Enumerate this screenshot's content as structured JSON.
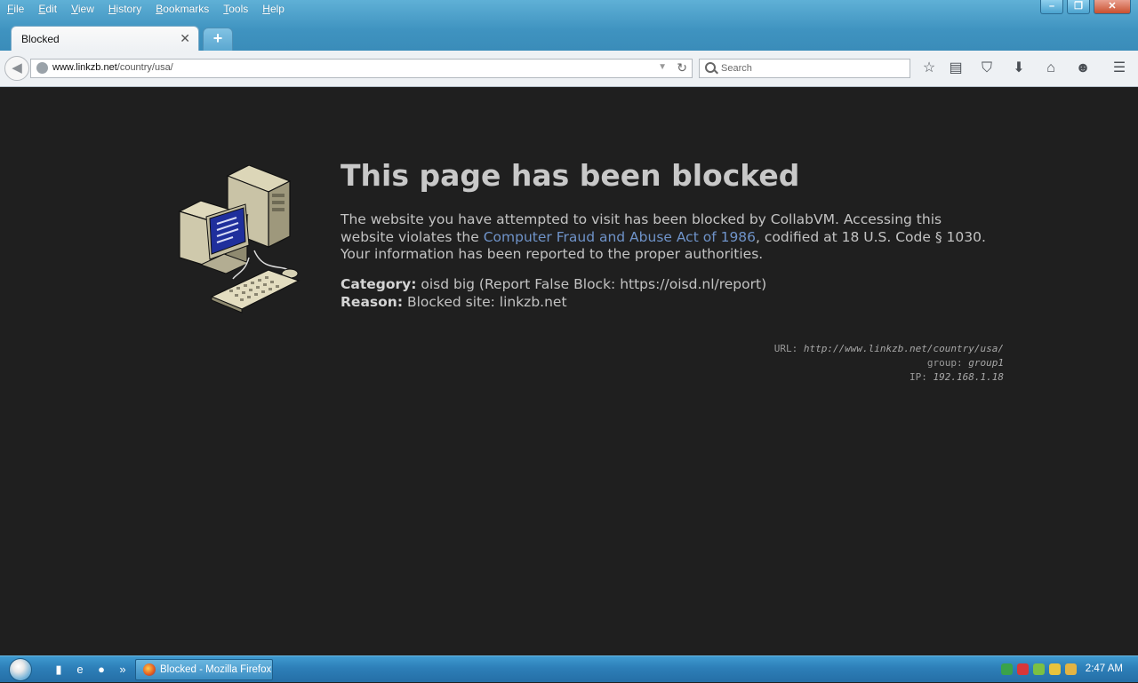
{
  "menu": [
    "File",
    "Edit",
    "View",
    "History",
    "Bookmarks",
    "Tools",
    "Help"
  ],
  "window_controls": {
    "minimize": "–",
    "restore": "❐",
    "close": "✕"
  },
  "tabs": [
    {
      "label": "Blocked",
      "active": true
    }
  ],
  "new_tab_label": "+",
  "navigation": {
    "url_host": "www.linkzb.net",
    "url_path": "/country/usa/",
    "search_placeholder": "Search"
  },
  "toolbar_icons": [
    "bookmark-star-icon",
    "reading-list-icon",
    "pocket-icon",
    "download-icon",
    "home-icon",
    "chat-icon",
    "hamburger-menu-icon"
  ],
  "page": {
    "headline": "This page has been blocked",
    "message_before": "The website you have attempted to visit has been blocked by CollabVM. Accessing this website violates the ",
    "message_link": "Computer Fraud and Abuse Act of 1986",
    "message_after": ", codified at 18 U.S. Code § 1030. Your information has been reported to the proper authorities.",
    "category_label": "Category:",
    "category_value": "oisd big (Report False Block: https://oisd.nl/report)",
    "reason_label": "Reason:",
    "reason_value": "Blocked site: linkzb.net",
    "meta": {
      "url_label": "URL:",
      "url_value": "http://www.linkzb.net/country/usa/",
      "group_label": "group:",
      "group_value": "group1",
      "ip_label": "IP:",
      "ip_value": "192.168.1.18"
    }
  },
  "taskbar": {
    "task_label": "Blocked - Mozilla Firefox",
    "clock": "2:47 AM",
    "overflow": "»"
  },
  "colors": {
    "page_background": "#1f1f1f",
    "link": "#6f93c9",
    "titlebar": "#3f93c0"
  }
}
